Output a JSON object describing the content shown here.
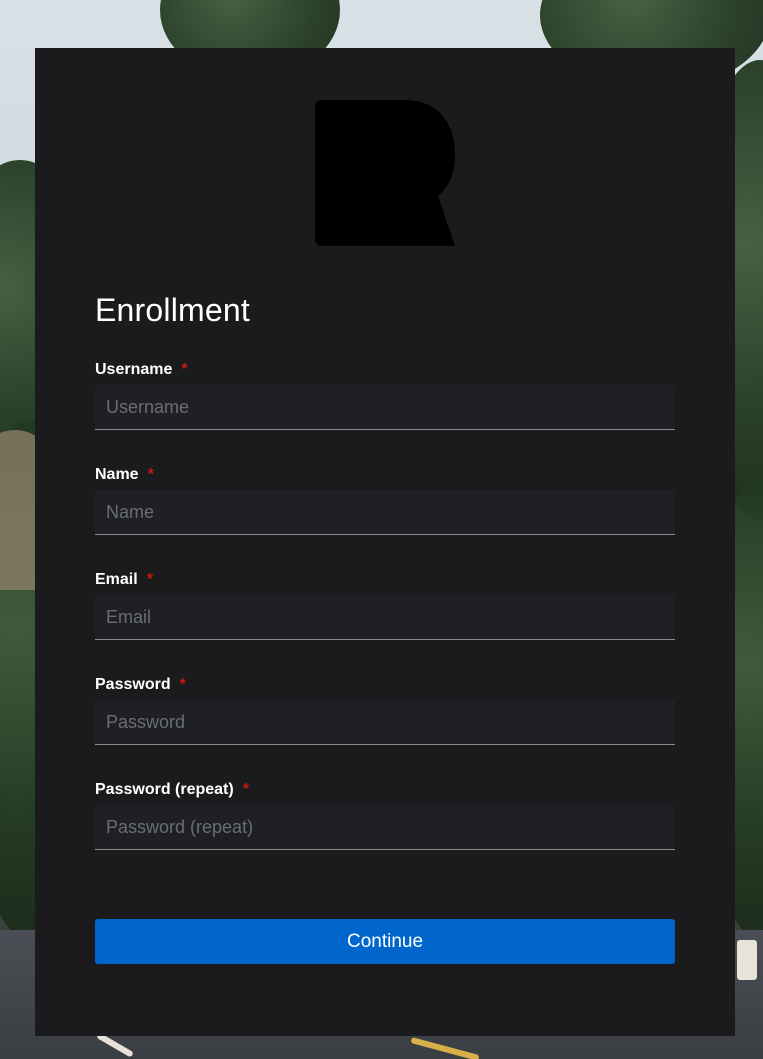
{
  "form": {
    "title": "Enrollment",
    "fields": [
      {
        "label": "Username",
        "required_mark": "*",
        "placeholder": "Username",
        "value": ""
      },
      {
        "label": "Name",
        "required_mark": "*",
        "placeholder": "Name",
        "value": ""
      },
      {
        "label": "Email",
        "required_mark": "*",
        "placeholder": "Email",
        "value": ""
      },
      {
        "label": "Password",
        "required_mark": "*",
        "placeholder": "Password",
        "value": ""
      },
      {
        "label": "Password (repeat)",
        "required_mark": "*",
        "placeholder": "Password (repeat)",
        "value": ""
      }
    ],
    "submit_label": "Continue"
  },
  "logo": {
    "icon": "brand-logo-icon",
    "color": "#000000"
  },
  "colors": {
    "card_background": "#1b1b1e",
    "input_background": "#1f2024",
    "primary_button": "#0066cc",
    "required_mark": "#c9190b",
    "text": "#ffffff",
    "placeholder": "#6a6e73"
  }
}
